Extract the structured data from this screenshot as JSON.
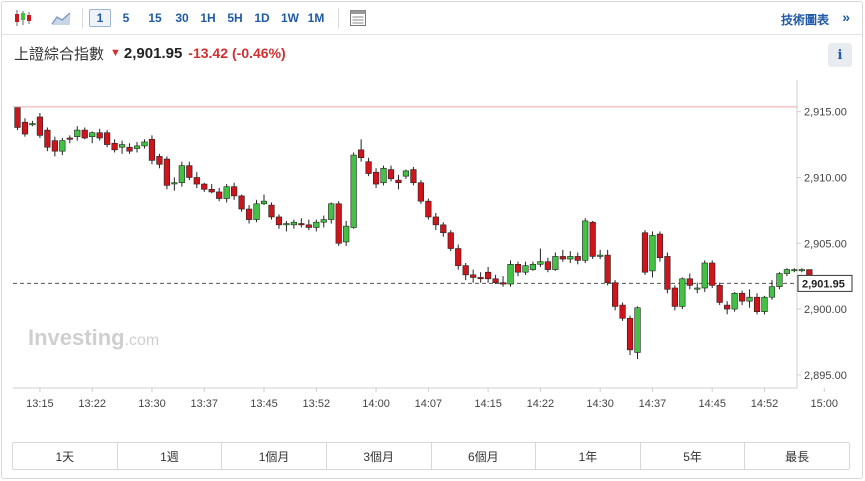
{
  "toolbar": {
    "periods": [
      "1",
      "5",
      "15",
      "30",
      "1H",
      "5H",
      "1D",
      "1W",
      "1M"
    ],
    "active_period": "1",
    "technical_label": "技術圖表",
    "chevron": "»"
  },
  "quote": {
    "name": "上證綜合指數",
    "last": "2,901.95",
    "change": "-13.42",
    "change_pct": "(-0.46%)",
    "direction": "down"
  },
  "info_label": "i",
  "watermark": {
    "brand": "Investing",
    "suffix": ".com"
  },
  "ranges": [
    "1天",
    "1週",
    "1個月",
    "3個月",
    "6個月",
    "1年",
    "5年",
    "最長"
  ],
  "colors": {
    "up": "#44c144",
    "down": "#d0141b",
    "accent": "#1f5aa6",
    "prev_close_line": "#f1a5a5",
    "last_price_tag": "#ffffff"
  },
  "chart_data": {
    "type": "candlestick",
    "interval_minutes": 1,
    "first_bar_time": "13:12",
    "ylim": [
      2894.0,
      2916.8
    ],
    "y_ticks": [
      2895.0,
      2900.0,
      2905.0,
      2910.0,
      2915.0
    ],
    "y_tick_labels": [
      "2,895.00",
      "2,900.00",
      "2,905.00",
      "2,910.00",
      "2,915.00"
    ],
    "x_tick_times": [
      "13:15",
      "13:22",
      "13:30",
      "13:37",
      "13:45",
      "13:52",
      "14:00",
      "14:07",
      "14:15",
      "14:22",
      "14:30",
      "14:37",
      "14:45",
      "14:52",
      "15:00"
    ],
    "prev_close": 2915.37,
    "last_price": 2901.95,
    "last_price_label": "2,901.95",
    "candles": [
      [
        2915.3,
        2915.3,
        2913.6,
        2913.8
      ],
      [
        2914.2,
        2914.5,
        2913.1,
        2913.3
      ],
      [
        2914.0,
        2914.3,
        2913.9,
        2914.1
      ],
      [
        2914.6,
        2914.9,
        2913.0,
        2913.2
      ],
      [
        2913.6,
        2913.8,
        2912.0,
        2912.3
      ],
      [
        2912.8,
        2913.1,
        2911.6,
        2912.0
      ],
      [
        2912.0,
        2913.0,
        2911.7,
        2912.8
      ],
      [
        2913.0,
        2913.2,
        2912.6,
        2912.9
      ],
      [
        2913.1,
        2913.9,
        2912.8,
        2913.6
      ],
      [
        2913.6,
        2913.8,
        2912.9,
        2913.0
      ],
      [
        2913.1,
        2913.5,
        2912.6,
        2913.4
      ],
      [
        2913.4,
        2913.7,
        2912.8,
        2913.0
      ],
      [
        2913.4,
        2913.6,
        2912.3,
        2912.5
      ],
      [
        2912.6,
        2912.9,
        2911.9,
        2912.1
      ],
      [
        2912.3,
        2912.8,
        2911.8,
        2912.5
      ],
      [
        2912.3,
        2912.6,
        2911.8,
        2912.0
      ],
      [
        2912.2,
        2912.7,
        2911.9,
        2912.4
      ],
      [
        2912.4,
        2912.9,
        2912.2,
        2912.7
      ],
      [
        2912.9,
        2913.2,
        2911.0,
        2911.3
      ],
      [
        2911.6,
        2911.8,
        2910.7,
        2911.0
      ],
      [
        2911.4,
        2911.6,
        2909.1,
        2909.4
      ],
      [
        2909.6,
        2910.0,
        2909.0,
        2909.6
      ],
      [
        2909.6,
        2911.2,
        2909.3,
        2910.9
      ],
      [
        2910.9,
        2911.2,
        2909.8,
        2910.0
      ],
      [
        2910.0,
        2910.4,
        2909.2,
        2909.5
      ],
      [
        2909.5,
        2909.6,
        2908.9,
        2909.1
      ],
      [
        2909.1,
        2909.5,
        2908.8,
        2908.9
      ],
      [
        2908.9,
        2909.2,
        2908.2,
        2908.4
      ],
      [
        2908.4,
        2909.5,
        2908.1,
        2909.3
      ],
      [
        2909.3,
        2909.6,
        2908.3,
        2908.6
      ],
      [
        2908.6,
        2908.7,
        2907.4,
        2907.6
      ],
      [
        2907.6,
        2907.9,
        2906.5,
        2906.8
      ],
      [
        2906.8,
        2908.3,
        2906.6,
        2908.0
      ],
      [
        2908.0,
        2908.7,
        2907.9,
        2908.2
      ],
      [
        2907.9,
        2908.1,
        2906.8,
        2907.0
      ],
      [
        2907.0,
        2907.2,
        2906.1,
        2906.4
      ],
      [
        2906.4,
        2906.7,
        2905.9,
        2906.5
      ],
      [
        2906.4,
        2906.8,
        2906.1,
        2906.6
      ],
      [
        2906.5,
        2906.9,
        2906.2,
        2906.4
      ],
      [
        2906.4,
        2906.8,
        2906.0,
        2906.2
      ],
      [
        2906.2,
        2906.8,
        2905.9,
        2906.6
      ],
      [
        2906.6,
        2907.1,
        2906.2,
        2906.8
      ],
      [
        2906.8,
        2908.1,
        2906.5,
        2908.0
      ],
      [
        2908.0,
        2908.2,
        2904.8,
        2905.0
      ],
      [
        2905.1,
        2906.7,
        2904.8,
        2906.3
      ],
      [
        2906.2,
        2911.9,
        2906.1,
        2911.7
      ],
      [
        2912.1,
        2912.9,
        2911.2,
        2911.5
      ],
      [
        2911.2,
        2911.5,
        2910.1,
        2910.3
      ],
      [
        2910.4,
        2910.7,
        2909.2,
        2909.5
      ],
      [
        2909.6,
        2910.9,
        2909.4,
        2910.7
      ],
      [
        2910.6,
        2910.9,
        2909.7,
        2909.9
      ],
      [
        2909.8,
        2910.2,
        2909.1,
        2909.6
      ],
      [
        2910.1,
        2910.6,
        2909.9,
        2910.5
      ],
      [
        2910.6,
        2910.8,
        2909.4,
        2909.6
      ],
      [
        2909.6,
        2909.8,
        2908.0,
        2908.2
      ],
      [
        2908.2,
        2908.4,
        2906.8,
        2907.0
      ],
      [
        2907.0,
        2907.3,
        2906.0,
        2906.4
      ],
      [
        2906.4,
        2906.6,
        2905.5,
        2905.8
      ],
      [
        2905.8,
        2906.0,
        2904.4,
        2904.6
      ],
      [
        2904.6,
        2904.9,
        2903.0,
        2903.3
      ],
      [
        2903.3,
        2903.5,
        2902.2,
        2902.6
      ],
      [
        2902.6,
        2903.0,
        2902.0,
        2902.4
      ],
      [
        2902.4,
        2902.8,
        2902.0,
        2902.3
      ],
      [
        2902.8,
        2903.2,
        2902.0,
        2902.3
      ],
      [
        2902.3,
        2902.6,
        2901.9,
        2902.0
      ],
      [
        2902.0,
        2902.5,
        2901.7,
        2901.9
      ],
      [
        2901.9,
        2903.7,
        2901.7,
        2903.4
      ],
      [
        2903.4,
        2903.6,
        2902.5,
        2902.8
      ],
      [
        2902.8,
        2903.6,
        2902.6,
        2903.3
      ],
      [
        2903.0,
        2903.6,
        2902.9,
        2903.4
      ],
      [
        2903.4,
        2904.6,
        2903.2,
        2903.6
      ],
      [
        2903.6,
        2903.9,
        2902.8,
        2903.0
      ],
      [
        2903.0,
        2904.3,
        2902.9,
        2904.0
      ],
      [
        2904.0,
        2904.5,
        2903.6,
        2903.8
      ],
      [
        2903.8,
        2904.4,
        2903.5,
        2904.0
      ],
      [
        2904.0,
        2904.3,
        2903.4,
        2903.7
      ],
      [
        2903.7,
        2906.9,
        2903.5,
        2906.7
      ],
      [
        2906.6,
        2906.7,
        2903.8,
        2904.0
      ],
      [
        2904.0,
        2904.5,
        2903.8,
        2904.1
      ],
      [
        2904.1,
        2904.5,
        2901.8,
        2902.0
      ],
      [
        2902.0,
        2902.2,
        2899.9,
        2900.2
      ],
      [
        2900.3,
        2900.5,
        2899.1,
        2899.3
      ],
      [
        2899.3,
        2899.5,
        2896.5,
        2896.9
      ],
      [
        2896.7,
        2900.2,
        2896.2,
        2900.1
      ],
      [
        2905.8,
        2906.0,
        2902.6,
        2902.8
      ],
      [
        2902.9,
        2905.9,
        2902.4,
        2905.6
      ],
      [
        2905.7,
        2905.9,
        2903.6,
        2903.9
      ],
      [
        2904.0,
        2904.3,
        2901.2,
        2901.5
      ],
      [
        2901.6,
        2901.8,
        2899.9,
        2900.2
      ],
      [
        2900.2,
        2902.4,
        2900.0,
        2902.3
      ],
      [
        2902.3,
        2902.7,
        2901.5,
        2901.8
      ],
      [
        2901.6,
        2902.0,
        2901.2,
        2901.6
      ],
      [
        2901.6,
        2903.7,
        2901.3,
        2903.5
      ],
      [
        2903.5,
        2903.7,
        2901.6,
        2901.8
      ],
      [
        2901.8,
        2902.0,
        2900.3,
        2900.5
      ],
      [
        2900.3,
        2900.6,
        2899.6,
        2900.0
      ],
      [
        2900.0,
        2901.3,
        2899.8,
        2901.2
      ],
      [
        2901.2,
        2901.4,
        2900.3,
        2900.6
      ],
      [
        2900.6,
        2901.5,
        2900.1,
        2900.9
      ],
      [
        2900.9,
        2901.2,
        2899.6,
        2899.8
      ],
      [
        2899.8,
        2901.0,
        2899.6,
        2900.9
      ],
      [
        2900.9,
        2902.2,
        2900.7,
        2901.7
      ],
      [
        2901.7,
        2902.8,
        2901.5,
        2902.7
      ],
      [
        2902.7,
        2903.1,
        2902.5,
        2903.0
      ],
      [
        2903.0,
        2903.1,
        2902.8,
        2903.0
      ],
      [
        2903.0,
        2903.1,
        2902.8,
        2903.0
      ],
      [
        2903.0,
        2903.0,
        2901.8,
        2901.95
      ]
    ]
  }
}
